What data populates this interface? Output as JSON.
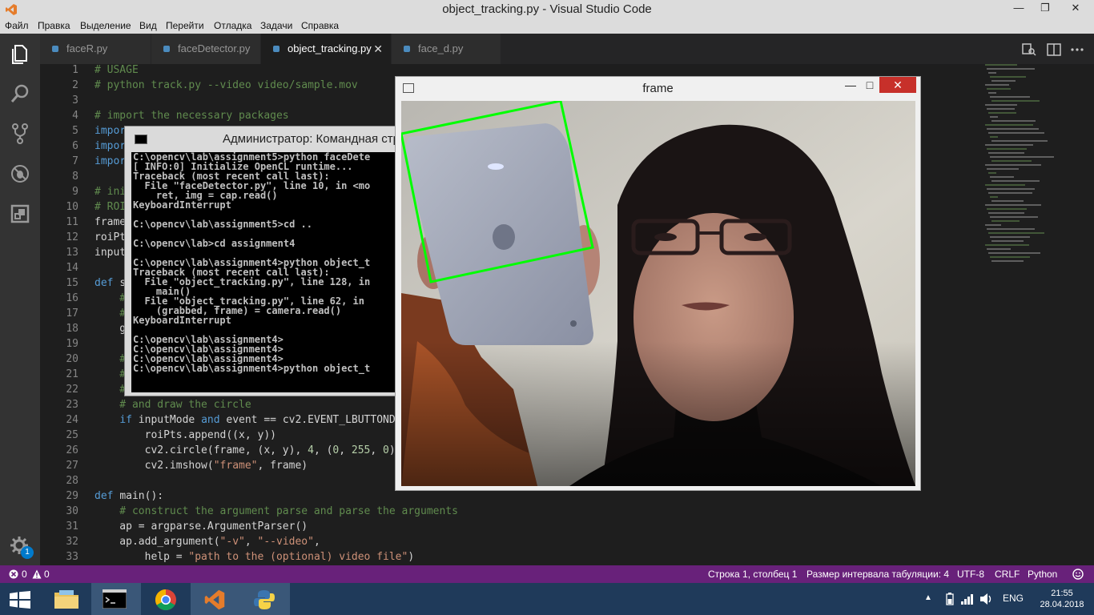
{
  "window": {
    "title": "object_tracking.py - Visual Studio Code",
    "minimize": "—",
    "maximize": "❐",
    "close": "✕"
  },
  "menu": [
    "Файл",
    "Правка",
    "Выделение",
    "Вид",
    "Перейти",
    "Отладка",
    "Задачи",
    "Справка"
  ],
  "tabs": [
    {
      "label": "faceR.py"
    },
    {
      "label": "faceDetector.py"
    },
    {
      "label": "object_tracking.py",
      "close": "✕"
    },
    {
      "label": "face_d.py"
    }
  ],
  "activity": {
    "badge": "1"
  },
  "editor": {
    "line_numbers": [
      "1",
      "2",
      "3",
      "4",
      "5",
      "6",
      "7",
      "8",
      "9",
      "10",
      "11",
      "12",
      "13",
      "14",
      "15",
      "16",
      "17",
      "18",
      "19",
      "20",
      "21",
      "22",
      "23",
      "24",
      "25",
      "26",
      "27",
      "28",
      "29",
      "30",
      "31",
      "32",
      "33"
    ],
    "lines": [
      [
        {
          "t": "# USAGE",
          "c": "comment"
        }
      ],
      [
        {
          "t": "# python track.py --video video/sample.mov",
          "c": "comment"
        }
      ],
      [
        {
          "t": "",
          "c": ""
        }
      ],
      [
        {
          "t": "# import the necessary packages",
          "c": "comment"
        }
      ],
      [
        {
          "t": "impor",
          "c": "kw"
        }
      ],
      [
        {
          "t": "impor",
          "c": "kw"
        }
      ],
      [
        {
          "t": "impor",
          "c": "kw"
        }
      ],
      [
        {
          "t": "",
          "c": ""
        }
      ],
      [
        {
          "t": "# ini",
          "c": "comment"
        }
      ],
      [
        {
          "t": "# ROI",
          "c": "comment"
        }
      ],
      [
        {
          "t": "frame",
          "c": ""
        }
      ],
      [
        {
          "t": "roiPt",
          "c": ""
        }
      ],
      [
        {
          "t": "input",
          "c": ""
        }
      ],
      [
        {
          "t": "",
          "c": ""
        }
      ],
      [
        {
          "t": "def ",
          "c": "kw"
        },
        {
          "t": "s",
          "c": ""
        }
      ],
      [
        {
          "t": "    #",
          "c": "comment"
        }
      ],
      [
        {
          "t": "    #",
          "c": "comment"
        }
      ],
      [
        {
          "t": "    g",
          "c": ""
        }
      ],
      [
        {
          "t": "",
          "c": ""
        }
      ],
      [
        {
          "t": "    #",
          "c": "comment"
        }
      ],
      [
        {
          "t": "    #",
          "c": "comment"
        }
      ],
      [
        {
          "t": "    #",
          "c": "comment"
        }
      ],
      [
        {
          "t": "    # and draw the circle",
          "c": "comment"
        }
      ],
      [
        {
          "t": "    ",
          "c": ""
        },
        {
          "t": "if",
          "c": "kw"
        },
        {
          "t": " inputMode ",
          "c": ""
        },
        {
          "t": "and",
          "c": "kw"
        },
        {
          "t": " event == cv2.EVENT_LBUTTONDO",
          "c": ""
        }
      ],
      [
        {
          "t": "        roiPts.append((x, y))",
          "c": ""
        }
      ],
      [
        {
          "t": "        cv2.circle(frame, (x, y), ",
          "c": ""
        },
        {
          "t": "4",
          "c": "num"
        },
        {
          "t": ", (",
          "c": ""
        },
        {
          "t": "0",
          "c": "num"
        },
        {
          "t": ", ",
          "c": ""
        },
        {
          "t": "255",
          "c": "num"
        },
        {
          "t": ", ",
          "c": ""
        },
        {
          "t": "0",
          "c": "num"
        },
        {
          "t": "),",
          "c": ""
        }
      ],
      [
        {
          "t": "        cv2.imshow(",
          "c": ""
        },
        {
          "t": "\"frame\"",
          "c": "str"
        },
        {
          "t": ", frame)",
          "c": ""
        }
      ],
      [
        {
          "t": "",
          "c": ""
        }
      ],
      [
        {
          "t": "def ",
          "c": "kw"
        },
        {
          "t": "main():",
          "c": ""
        }
      ],
      [
        {
          "t": "    # construct the argument parse and parse the arguments",
          "c": "comment"
        }
      ],
      [
        {
          "t": "    ap = argparse.ArgumentParser()",
          "c": ""
        }
      ],
      [
        {
          "t": "    ap.add_argument(",
          "c": ""
        },
        {
          "t": "\"-v\"",
          "c": "str"
        },
        {
          "t": ", ",
          "c": ""
        },
        {
          "t": "\"--video\"",
          "c": "str"
        },
        {
          "t": ",",
          "c": ""
        }
      ],
      [
        {
          "t": "        help = ",
          "c": ""
        },
        {
          "t": "\"path to the (optional) video file\"",
          "c": "str"
        },
        {
          "t": ")",
          "c": ""
        }
      ]
    ]
  },
  "cmd": {
    "title": "Администратор: Командная стр",
    "lines": [
      "C:\\opencv\\lab\\assignment5>python faceDete",
      "[ INFO:0] Initialize OpenCL runtime...",
      "Traceback (most recent call last):",
      "  File \"faceDetector.py\", line 10, in <mo",
      "    ret, img = cap.read()",
      "KeyboardInterrupt",
      "",
      "C:\\opencv\\lab\\assignment5>cd ..",
      "",
      "C:\\opencv\\lab>cd assignment4",
      "",
      "C:\\opencv\\lab\\assignment4>python object_t",
      "Traceback (most recent call last):",
      "  File \"object_tracking.py\", line 128, in",
      "    main()",
      "  File \"object_tracking.py\", line 62, in",
      "    (grabbed, frame) = camera.read()",
      "KeyboardInterrupt",
      "",
      "C:\\opencv\\lab\\assignment4>",
      "C:\\opencv\\lab\\assignment4>",
      "C:\\opencv\\lab\\assignment4>",
      "C:\\opencv\\lab\\assignment4>python object_t"
    ]
  },
  "frame_window": {
    "title": "frame",
    "minimize": "—",
    "maximize": "□",
    "close": "✕"
  },
  "statusbar": {
    "errors": "0",
    "warnings": "0",
    "position": "Строка 1, столбец 1",
    "indent": "Размер интервала табуляции: 4",
    "encoding": "UTF-8",
    "eol": "CRLF",
    "language": "Python"
  },
  "taskbar": {
    "language": "ENG",
    "time": "21:55",
    "date": "28.04.2018"
  },
  "colors": {
    "statusbar": "#68217a",
    "activity_badge": "#007acc",
    "tracking_box": "#00ff00"
  }
}
